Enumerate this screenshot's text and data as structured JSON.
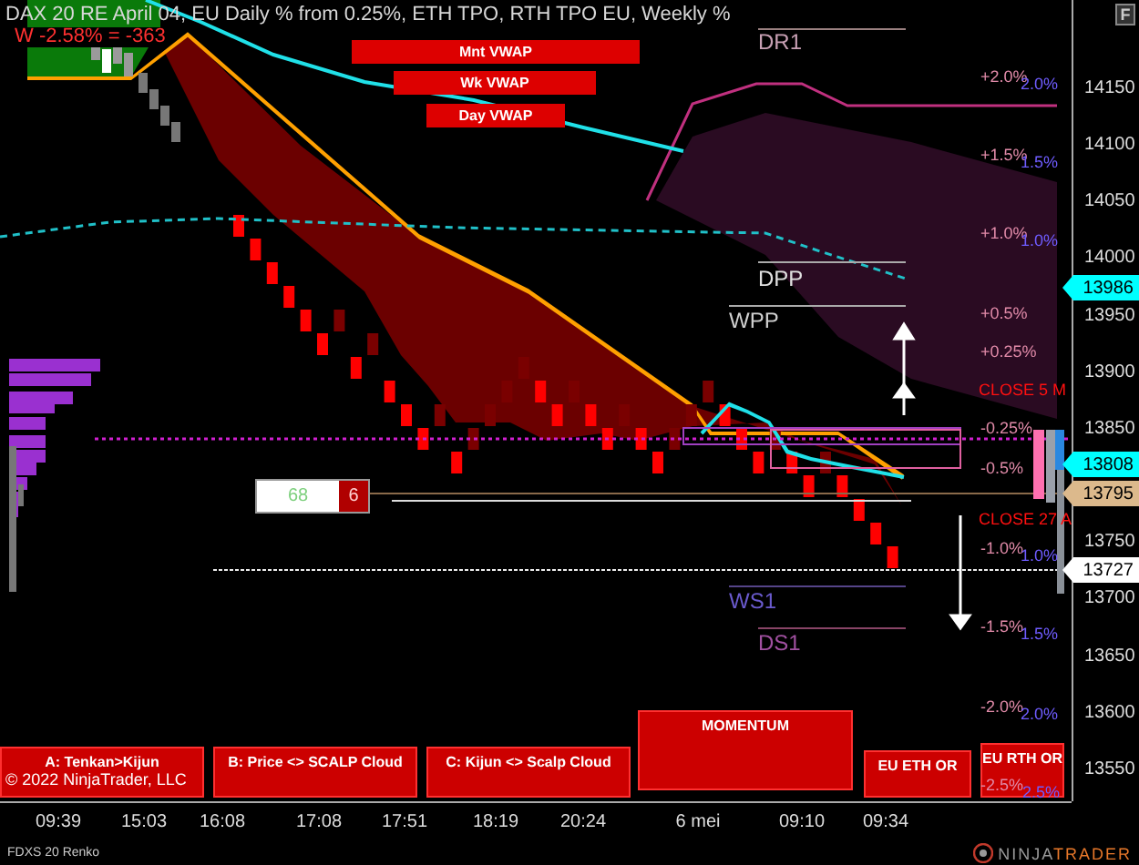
{
  "chart": {
    "title": "DAX 20  RE April 04, EU Daily % from 0.25%, ETH TPO, RTH TPO EU, Weekly %",
    "weekly_change": "W -2.58% = -363",
    "vwap_buttons": [
      "Mnt VWAP",
      "Wk VWAP",
      "Day VWAP"
    ],
    "pivot_labels": [
      {
        "text": "DR1",
        "color": "#c8a0b4"
      },
      {
        "text": "DPP",
        "color": "#e0e0e0"
      },
      {
        "text": "WPP",
        "color": "#d0d0d0"
      },
      {
        "text": "WS1",
        "color": "#6a5acd"
      },
      {
        "text": "DS1",
        "color": "#a050a0"
      }
    ],
    "percent_levels": [
      {
        "daily": "+2.0%",
        "weekly": "2.0%"
      },
      {
        "daily": "+1.5%",
        "weekly": "1.5%"
      },
      {
        "daily": "+1.0%",
        "weekly": "1.0%"
      },
      {
        "daily": "+0.5%"
      },
      {
        "daily": "+0.25%"
      },
      {
        "daily": "-0.25%"
      },
      {
        "daily": "-0.5%"
      },
      {
        "daily": "-1.0%",
        "weekly": "1.0%"
      },
      {
        "daily": "-1.5%",
        "weekly": "1.5%"
      },
      {
        "daily": "-2.0%",
        "weekly": "2.0%"
      },
      {
        "daily": "-2.5%",
        "weekly": "2.5%"
      }
    ],
    "close_labels": [
      "CLOSE 5 M",
      "CLOSE 27 A"
    ],
    "counter": {
      "value": "68",
      "bricks": "6"
    },
    "signal_panels": [
      "A: Tenkan>Kijun",
      "B: Price <> SCALP Cloud",
      "C: Kijun <> Scalp Cloud",
      "MOMENTUM",
      "EU ETH OR",
      "EU RTH OR"
    ],
    "copyright": "© 2022 NinjaTrader, LLC"
  },
  "price_axis": {
    "button": "F",
    "ticks": [
      "14150",
      "14100",
      "14050",
      "14000",
      "13950",
      "13900",
      "13850",
      "13750",
      "13700",
      "13650",
      "13600",
      "13550"
    ],
    "tags": [
      {
        "text": "13986",
        "color": "#00ffff"
      },
      {
        "text": "13808",
        "color": "#00ffff"
      },
      {
        "text": "13795",
        "color": "#dcb98c"
      },
      {
        "text": "13727",
        "color": "#ffffff"
      }
    ]
  },
  "time_axis": [
    "09:39",
    "15:03",
    "16:08",
    "17:08",
    "17:51",
    "18:19",
    "20:24",
    "6 mei",
    "09:10",
    "09:34"
  ],
  "footer": {
    "instrument": "FDXS 20 Renko",
    "brand": [
      "NINJA",
      "TRADER"
    ]
  }
}
